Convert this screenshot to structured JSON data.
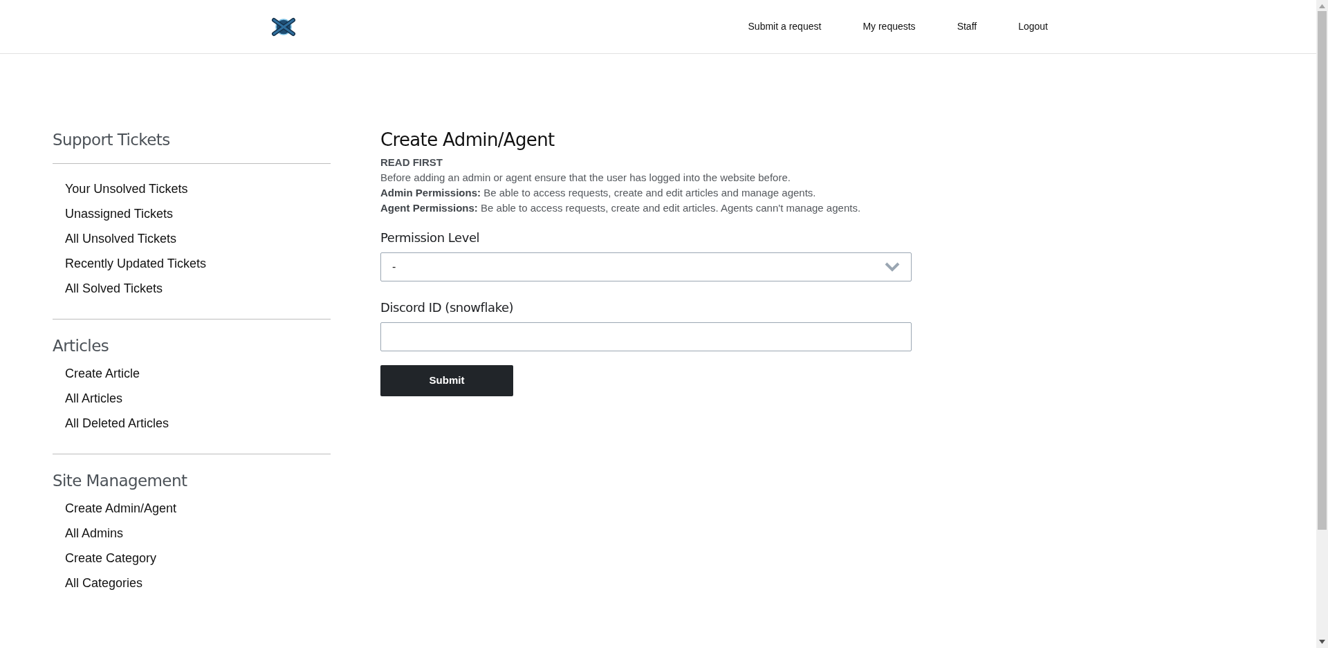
{
  "header": {
    "nav": [
      "Submit a request",
      "My requests",
      "Staff",
      "Logout"
    ]
  },
  "sidebar": {
    "sections": [
      {
        "title": "Support Tickets",
        "items": [
          "Your Unsolved Tickets",
          "Unassigned Tickets",
          "All Unsolved Tickets",
          "Recently Updated Tickets",
          "All Solved Tickets"
        ]
      },
      {
        "title": "Articles",
        "items": [
          "Create Article",
          "All Articles",
          "All Deleted Articles"
        ]
      },
      {
        "title": "Site Management",
        "items": [
          "Create Admin/Agent",
          "All Admins",
          "Create Category",
          "All Categories"
        ]
      }
    ]
  },
  "main": {
    "title": "Create Admin/Agent",
    "notice": [
      {
        "kind": "heading",
        "text": "READ FIRST"
      },
      {
        "kind": "line",
        "text": "Before adding an admin or agent ensure that the user has logged into the website before."
      },
      {
        "kind": "line",
        "text": "**Admin Permissions:** Be able to access requests, create and edit articles and manage agents."
      },
      {
        "kind": "line",
        "text": "**Agent Permissions:** Be able to access requests, create and edit articles. Agents cann't manage agents."
      }
    ],
    "fields": [
      {
        "kind": "select",
        "label": "Permission Level",
        "value": "-"
      },
      {
        "kind": "text",
        "label": "Discord ID (snowflake)"
      }
    ],
    "submit": "Submit"
  }
}
